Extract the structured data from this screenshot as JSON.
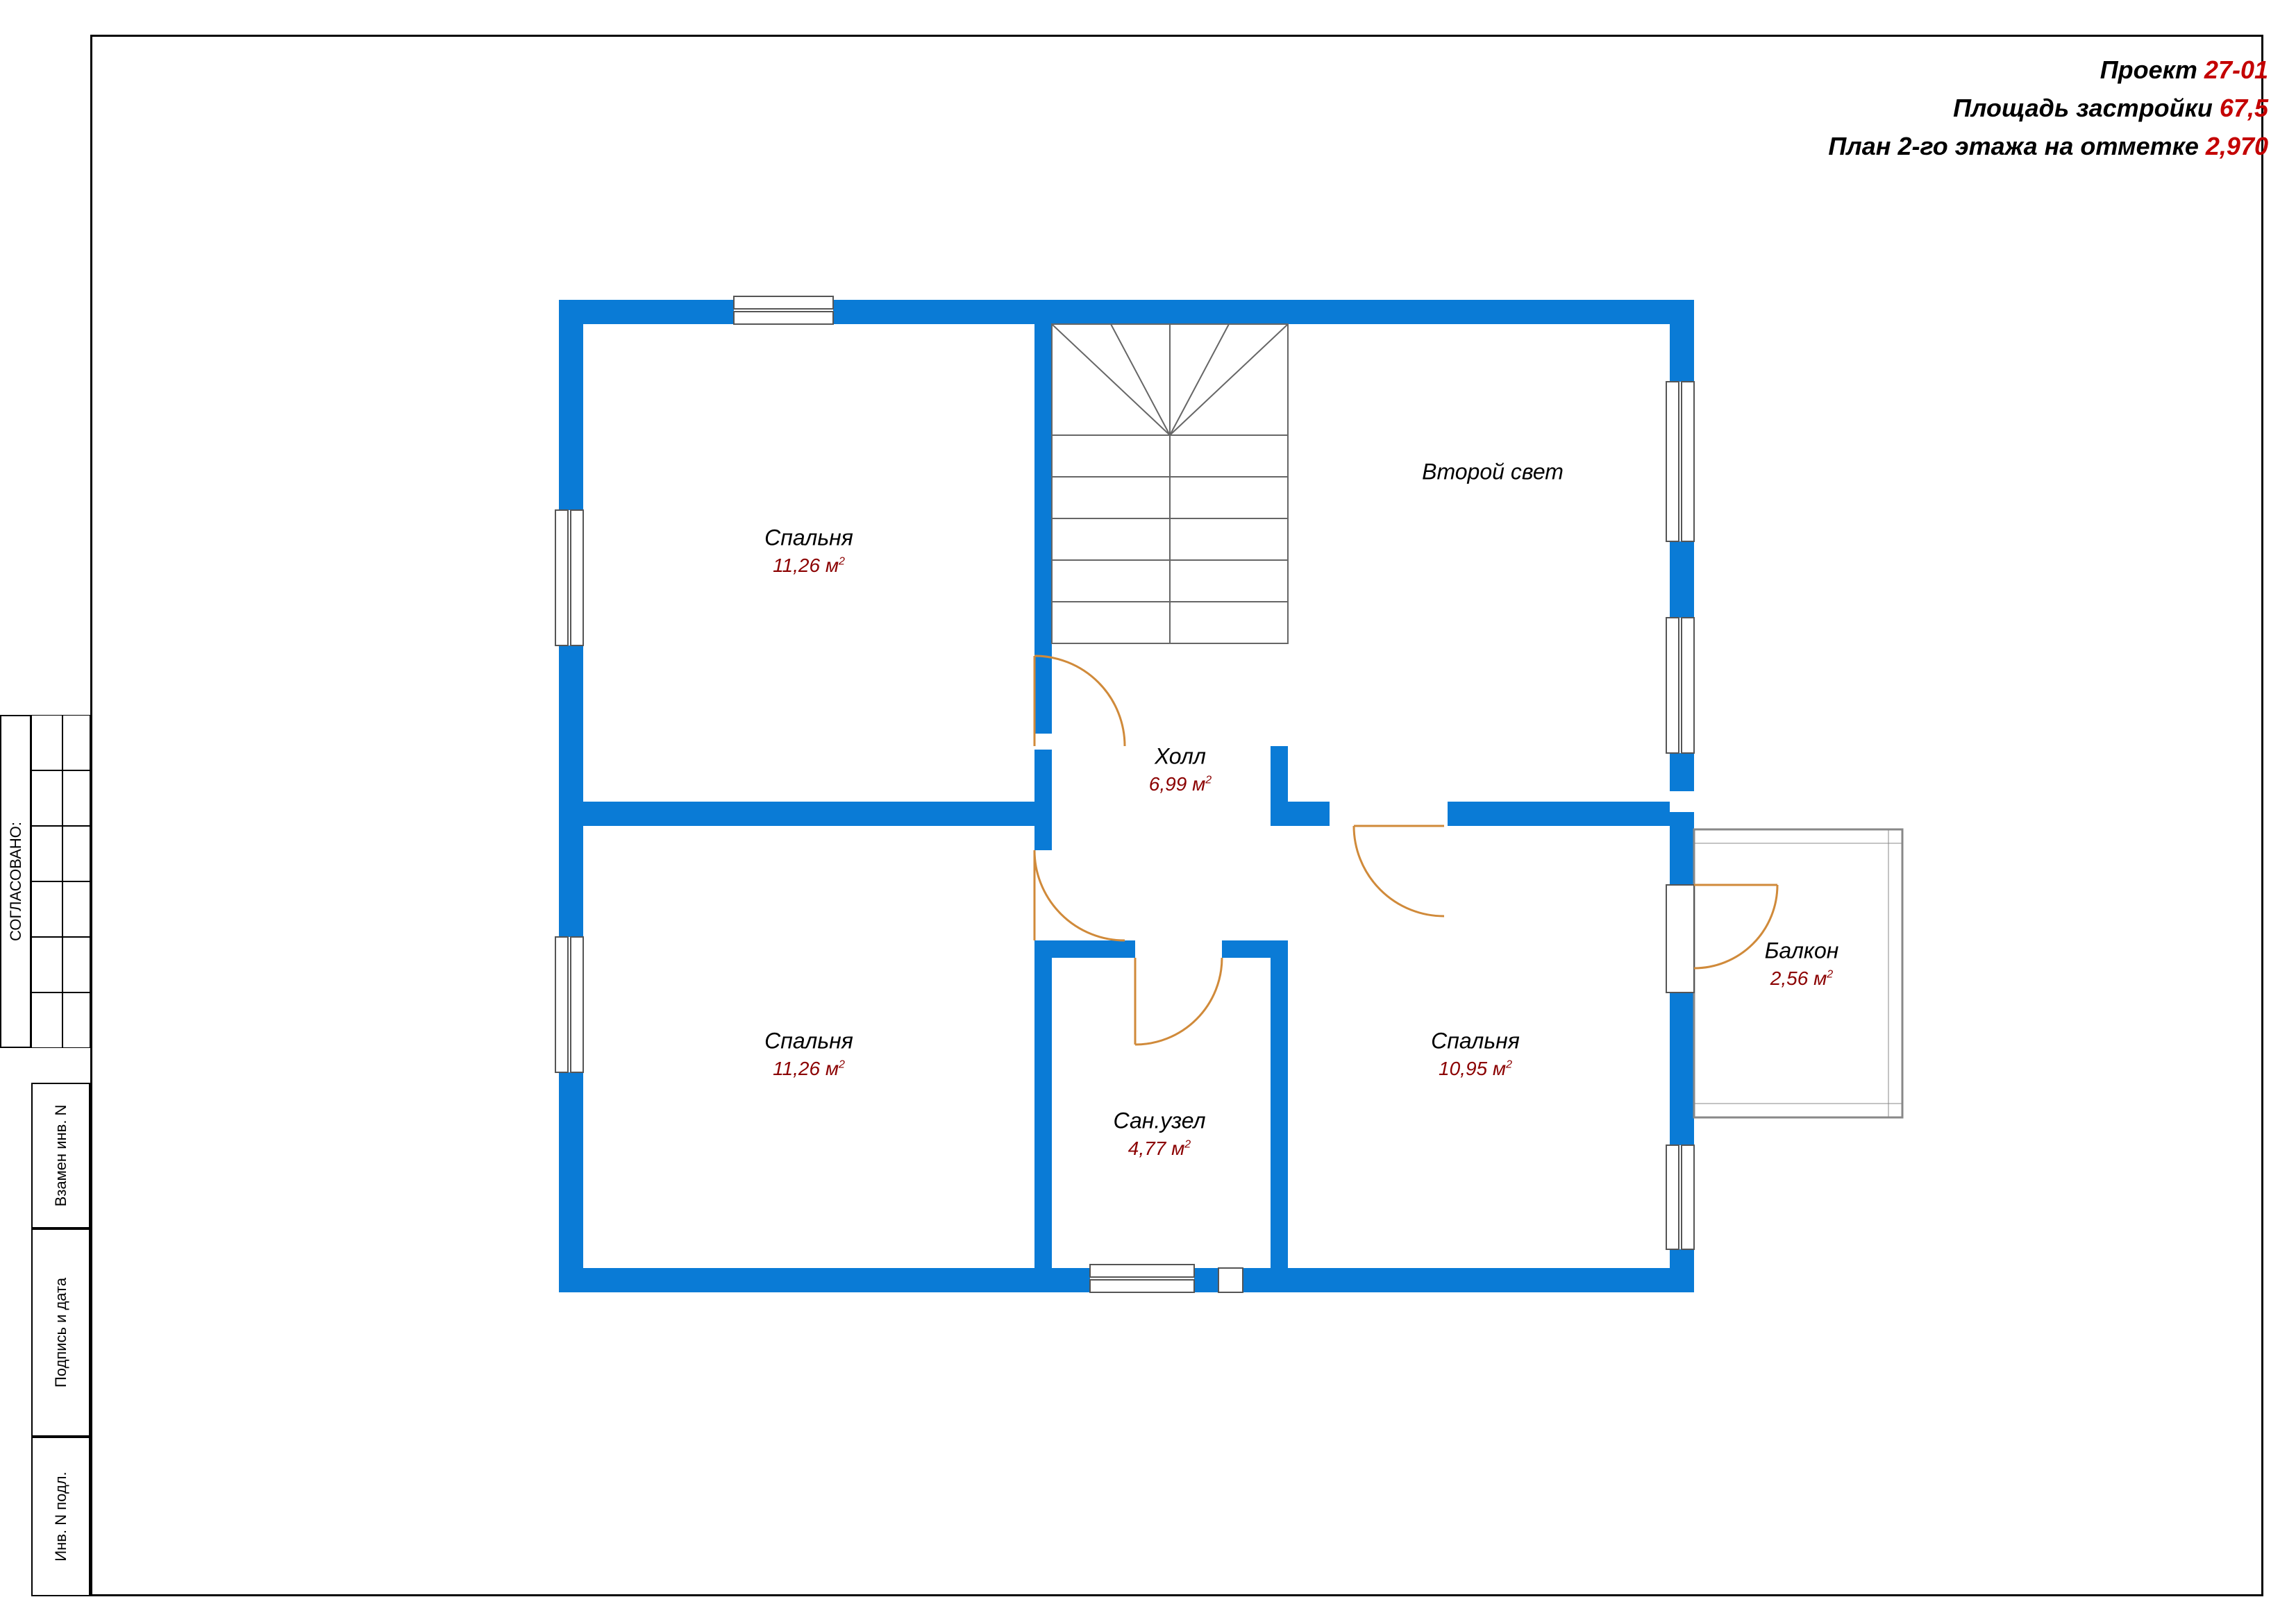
{
  "header": {
    "project_label": "Проект",
    "project_number": "27-01",
    "footprint_label": "Площадь застройки",
    "footprint_value": "67,5",
    "plan_label": "План 2-го этажа на отметке",
    "plan_value": "2,970"
  },
  "sidebar": {
    "approved": "СОГЛАСОВАНО:",
    "inv_replace": "Взамен инв. N",
    "sign_date": "Подпись и дата",
    "inv_orig": "Инв. N подл."
  },
  "rooms": {
    "bedroom_tl": {
      "name": "Спальня",
      "area": "11,26 м",
      "sup": "2"
    },
    "bedroom_bl": {
      "name": "Спальня",
      "area": "11,26 м",
      "sup": "2"
    },
    "bedroom_br": {
      "name": "Спальня",
      "area": "10,95 м",
      "sup": "2"
    },
    "hall": {
      "name": "Холл",
      "area": "6,99 м",
      "sup": "2"
    },
    "wc": {
      "name": "Сан.узел",
      "area": "4,77 м",
      "sup": "2"
    },
    "void": {
      "name": "Второй свет"
    },
    "balcony": {
      "name": "Балкон",
      "area": "2,56 м",
      "sup": "2"
    }
  },
  "colors": {
    "wall": "#0a7bd6",
    "window_fill": "#ffffff",
    "door": "#d08a3a"
  }
}
